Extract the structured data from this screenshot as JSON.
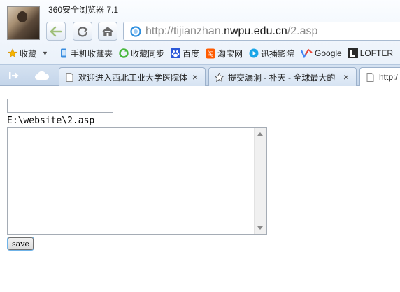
{
  "window": {
    "title": "360安全浏览器 7.1"
  },
  "address_bar": {
    "url_prefix": "http://tijianzhan.",
    "url_domain": "nwpu.edu.cn",
    "url_suffix": "/2.asp"
  },
  "bookmarks": [
    {
      "label": "收藏",
      "icon": "star-icon"
    },
    {
      "label": "手机收藏夹",
      "icon": "phone-icon"
    },
    {
      "label": "收藏同步",
      "icon": "sync-icon"
    },
    {
      "label": "百度",
      "icon": "baidu-paw-icon"
    },
    {
      "label": "淘宝网",
      "icon": "taobao-icon"
    },
    {
      "label": "迅播影院",
      "icon": "play-icon"
    },
    {
      "label": "Google",
      "icon": "google-icon"
    },
    {
      "label": "LOFTER",
      "icon": "lofter-icon"
    }
  ],
  "tabs": [
    {
      "label": "欢迎进入西北工业大学医院体",
      "icon": "page-icon",
      "close": "×"
    },
    {
      "label": "提交漏洞 - 补天 - 全球最大的",
      "icon": "butian-icon",
      "close": "×"
    },
    {
      "label": "http:/",
      "icon": "page-icon",
      "close": ""
    }
  ],
  "form": {
    "path_input_value": "",
    "path_text": "E:\\website\\2.asp",
    "content_value": "",
    "save_label": "save"
  },
  "colors": {
    "accent": "#6fb3e8",
    "chrome_bg": "#eef4fb"
  }
}
